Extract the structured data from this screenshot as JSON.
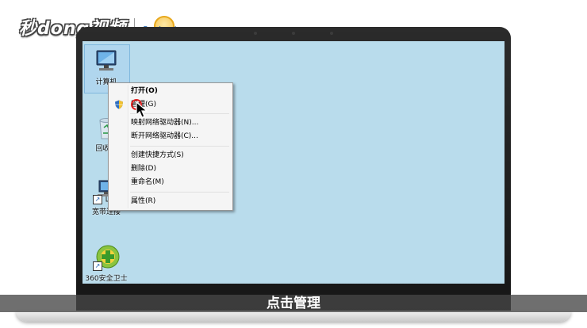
{
  "watermark": {
    "brand": "秒dong视频"
  },
  "desktop": {
    "icons": [
      {
        "label": "计算机",
        "icon": "computer-icon",
        "selected": true
      },
      {
        "label": "回收站",
        "icon": "recycle-bin-icon",
        "selected": false
      },
      {
        "label": "宽带连接",
        "icon": "network-icon",
        "selected": false
      },
      {
        "label": "360安全卫士",
        "icon": "security-icon",
        "selected": false
      }
    ],
    "background": "#b9dcec"
  },
  "context_menu": {
    "items": [
      {
        "label": "打开(O)",
        "bold": true
      },
      {
        "label": "管理(G)",
        "icon": "uac-shield-icon"
      },
      {
        "label": "映射网络驱动器(N)..."
      },
      {
        "label": "断开网络驱动器(C)..."
      },
      {
        "label": "创建快捷方式(S)"
      },
      {
        "label": "删除(D)"
      },
      {
        "label": "重命名(M)"
      },
      {
        "label": "属性(R)"
      }
    ]
  },
  "subtitle": {
    "text": "点击管理"
  }
}
